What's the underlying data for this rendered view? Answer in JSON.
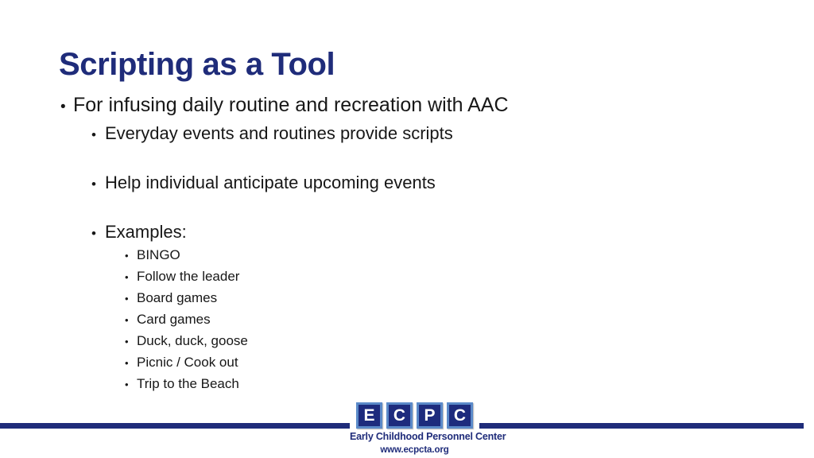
{
  "slide": {
    "title": "Scripting as a Tool",
    "title_color": "#1f2c7a",
    "background_color": "#ffffff",
    "body_text_color": "#171717",
    "bullet_glyph": "•",
    "outline": [
      {
        "level": 1,
        "text": "For infusing daily routine and recreation with AAC"
      },
      {
        "level": 2,
        "text": "Everyday events and routines provide scripts"
      },
      {
        "level": 2,
        "text": "Help individual anticipate upcoming events"
      },
      {
        "level": 2,
        "text": "Examples:"
      },
      {
        "level": 3,
        "text": "BINGO"
      },
      {
        "level": 3,
        "text": "Follow the leader"
      },
      {
        "level": 3,
        "text": "Board games"
      },
      {
        "level": 3,
        "text": "Card games"
      },
      {
        "level": 3,
        "text": "Duck, duck, goose"
      },
      {
        "level": 3,
        "text": "Picnic / Cook out"
      },
      {
        "level": 3,
        "text": "Trip to the Beach"
      }
    ]
  },
  "footer": {
    "rule_color": "#1f2c7a",
    "logo": {
      "letters": [
        "E",
        "C",
        "P",
        "C"
      ],
      "name": "Early Childhood Personnel Center",
      "url": "www.ecpcta.org",
      "tile_color": "#1d2b7d",
      "tile_border_color": "#5b8ac9",
      "text_color": "#1f2c7a"
    }
  }
}
